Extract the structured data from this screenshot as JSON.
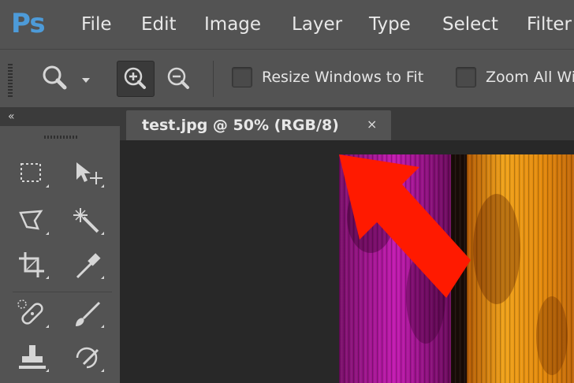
{
  "app": {
    "logo": "Ps",
    "accent_color": "#4d9bd9"
  },
  "menu": {
    "items": [
      "File",
      "Edit",
      "Image",
      "Layer",
      "Type",
      "Select",
      "Filter"
    ]
  },
  "options_bar": {
    "tool_icon": "zoom-tool-icon",
    "zoom_in_icon": "zoom-in-icon",
    "zoom_out_icon": "zoom-out-icon",
    "resize_windows_label": "Resize Windows to Fit",
    "zoom_all_windows_label": "Zoom All Wi"
  },
  "tools_panel": {
    "collapse_icon": "«",
    "tools": [
      "rectangular-marquee-icon",
      "move-icon",
      "lasso-icon",
      "magic-wand-icon",
      "crop-icon",
      "eyedropper-icon",
      "spot-healing-icon",
      "brush-icon",
      "clone-stamp-icon",
      "history-brush-icon"
    ]
  },
  "document": {
    "tab_title": "test.jpg @ 50% (RGB/8)",
    "close_glyph": "×"
  },
  "annotation": {
    "arrow_color": "#ff1a00"
  }
}
